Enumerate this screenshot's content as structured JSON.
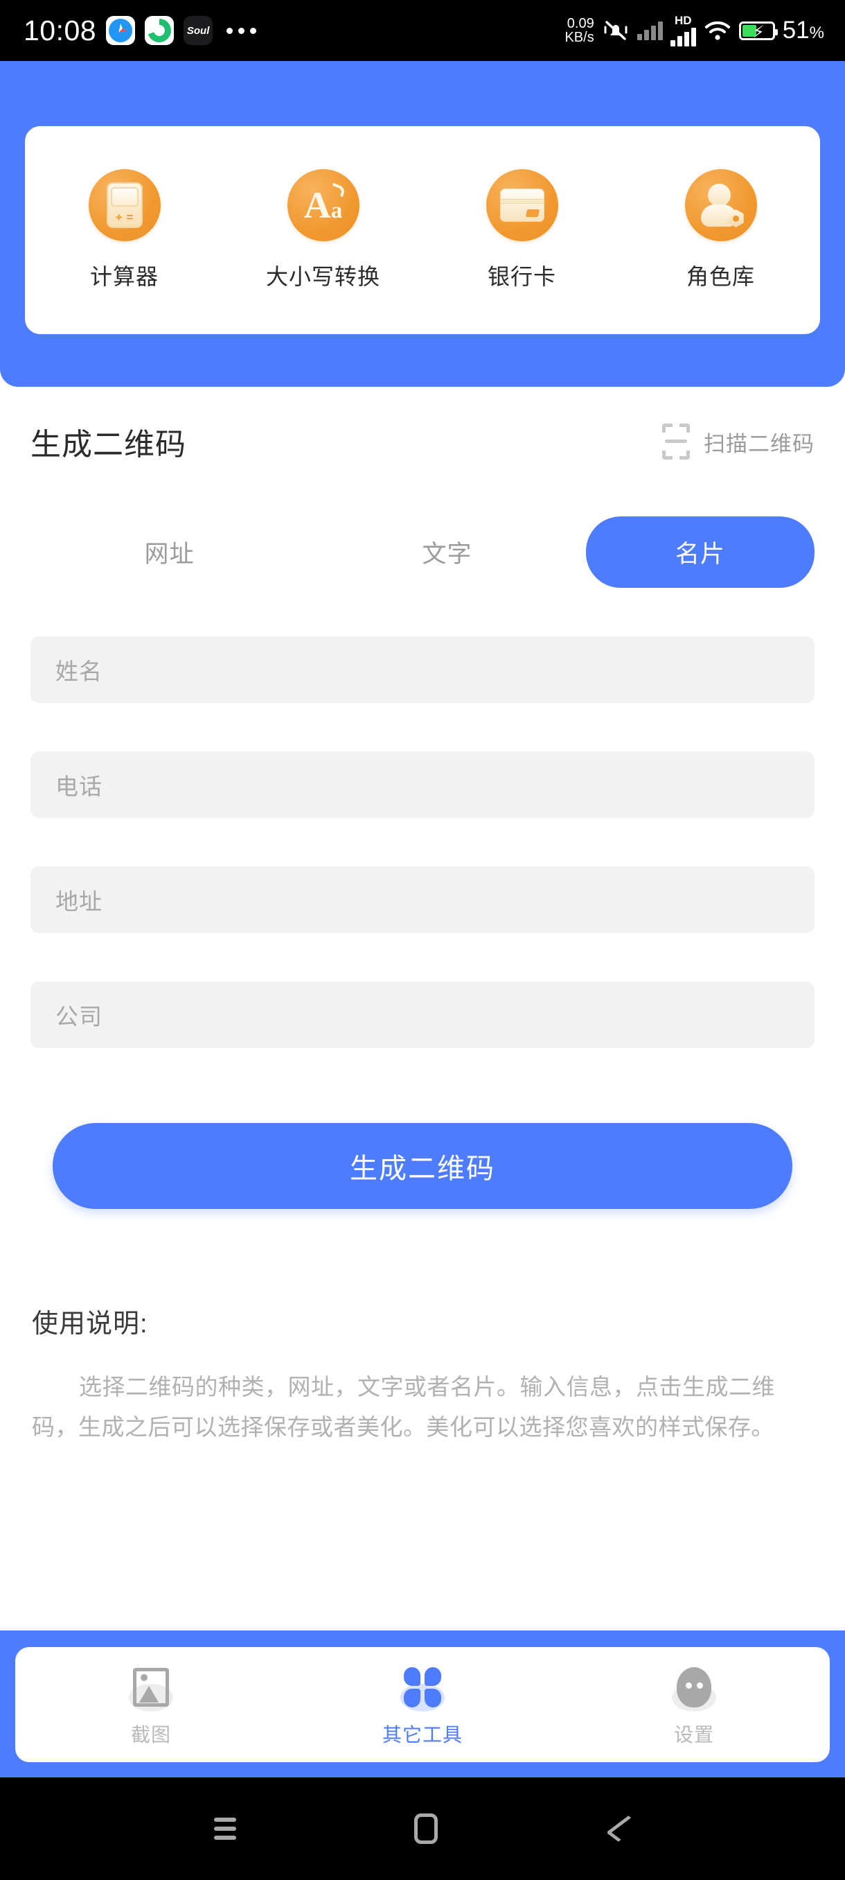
{
  "statusbar": {
    "time": "10:08",
    "app_icons": [
      "safari-icon",
      "green-spiral-icon",
      "soul-icon"
    ],
    "soul_label": "Soul",
    "network_speed_value": "0.09",
    "network_speed_unit": "KB/s",
    "hd_label": "HD",
    "battery_percent": "51",
    "battery_percent_symbol": "%",
    "icons": [
      "mute-vibrate-icon",
      "no-signal-icon",
      "hd-signal-icon",
      "wifi-icon",
      "battery-charging-icon"
    ]
  },
  "tools_card": {
    "items": [
      {
        "label": "计算器",
        "icon": "calculator-icon"
      },
      {
        "label": "大小写转换",
        "icon": "case-convert-icon"
      },
      {
        "label": "银行卡",
        "icon": "bank-card-icon"
      },
      {
        "label": "角色库",
        "icon": "role-library-icon"
      }
    ]
  },
  "qr_section": {
    "title": "生成二维码",
    "scan_label": "扫描二维码",
    "scan_icon": "scan-qr-icon",
    "tabs": [
      {
        "label": "网址",
        "active": false
      },
      {
        "label": "文字",
        "active": false
      },
      {
        "label": "名片",
        "active": true
      }
    ],
    "fields": [
      {
        "placeholder": "姓名"
      },
      {
        "placeholder": "电话"
      },
      {
        "placeholder": "地址"
      },
      {
        "placeholder": "公司"
      }
    ],
    "generate_button": "生成二维码"
  },
  "usage": {
    "title": "使用说明:",
    "body": "选择二维码的种类，网址，文字或者名片。输入信息，点击生成二维码，生成之后可以选择保存或者美化。美化可以选择您喜欢的样式保存。"
  },
  "bottom_nav": {
    "items": [
      {
        "label": "截图",
        "icon": "screenshot-icon",
        "active": false
      },
      {
        "label": "其它工具",
        "icon": "tools-icon",
        "active": true
      },
      {
        "label": "设置",
        "icon": "settings-icon",
        "active": false
      }
    ]
  },
  "android_nav": {
    "items": [
      {
        "icon": "menu-icon"
      },
      {
        "icon": "home-icon"
      },
      {
        "icon": "back-icon"
      }
    ]
  },
  "colors": {
    "brand_blue": "#4d7cfe",
    "icon_orange": "#f0982f",
    "field_gray": "#f2f2f2",
    "muted_text": "#b1b1b1"
  }
}
